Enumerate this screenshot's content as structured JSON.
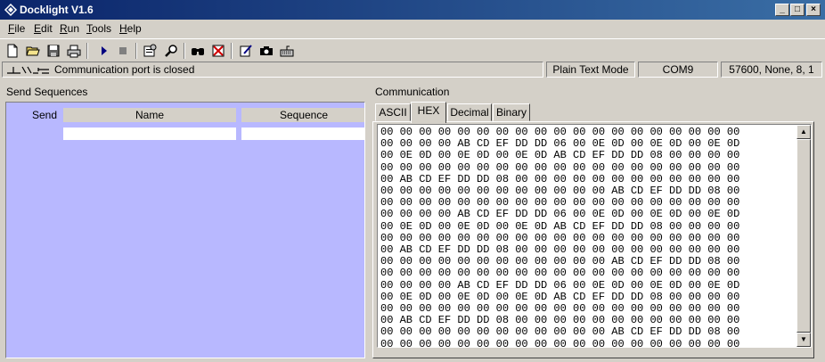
{
  "window": {
    "title": "Docklight V1.6"
  },
  "menu": [
    {
      "pre": "",
      "ul": "F",
      "post": "ile"
    },
    {
      "pre": "",
      "ul": "E",
      "post": "dit"
    },
    {
      "pre": "",
      "ul": "R",
      "post": "un"
    },
    {
      "pre": "",
      "ul": "T",
      "post": "ools"
    },
    {
      "pre": "",
      "ul": "H",
      "post": "elp"
    }
  ],
  "toolbar_icons": [
    "new-document-icon",
    "open-folder-icon",
    "save-disk-icon",
    "print-icon",
    "run-play-icon",
    "stop-icon",
    "settings-icon",
    "find-icon",
    "binoculars-icon",
    "clear-icon",
    "edit-icon",
    "snapshot-camera-icon",
    "keyboard-icon"
  ],
  "status": {
    "port_message": "Communication port is closed",
    "mode": "Plain Text Mode",
    "port": "COM9",
    "settings": "57600, None, 8, 1"
  },
  "send_sequences": {
    "label": "Send Sequences",
    "columns": {
      "send": "Send",
      "name": "Name",
      "sequence": "Sequence"
    }
  },
  "communication": {
    "label": "Communication",
    "tabs": [
      "ASCII",
      "HEX",
      "Decimal",
      "Binary"
    ],
    "active_tab": "HEX",
    "hex_lines": [
      "00 00 00 00 00 00 00 00 00 00 00 00 00 00 00 00 00 00 00",
      "00 00 00 00 AB CD EF DD DD 06 00 0E 0D 00 0E 0D 00 0E 0D",
      "00 0E 0D 00 0E 0D 00 0E 0D AB CD EF DD DD 08 00 00 00 00",
      "00 00 00 00 00 00 00 00 00 00 00 00 00 00 00 00 00 00 00",
      "00 AB CD EF DD DD 08 00 00 00 00 00 00 00 00 00 00 00 00",
      "00 00 00 00 00 00 00 00 00 00 00 00 AB CD EF DD DD 08 00",
      "00 00 00 00 00 00 00 00 00 00 00 00 00 00 00 00 00 00 00",
      "00 00 00 00 AB CD EF DD DD 06 00 0E 0D 00 0E 0D 00 0E 0D",
      "00 0E 0D 00 0E 0D 00 0E 0D AB CD EF DD DD 08 00 00 00 00",
      "00 00 00 00 00 00 00 00 00 00 00 00 00 00 00 00 00 00 00",
      "00 AB CD EF DD DD 08 00 00 00 00 00 00 00 00 00 00 00 00",
      "00 00 00 00 00 00 00 00 00 00 00 00 AB CD EF DD DD 08 00",
      "00 00 00 00 00 00 00 00 00 00 00 00 00 00 00 00 00 00 00",
      "00 00 00 00 AB CD EF DD DD 06 00 0E 0D 00 0E 0D 00 0E 0D",
      "00 0E 0D 00 0E 0D 00 0E 0D AB CD EF DD DD 08 00 00 00 00",
      "00 00 00 00 00 00 00 00 00 00 00 00 00 00 00 00 00 00 00",
      "00 AB CD EF DD DD 08 00 00 00 00 00 00 00 00 00 00 00 00",
      "00 00 00 00 00 00 00 00 00 00 00 00 AB CD EF DD DD 08 00",
      "00 00 00 00 00 00 00 00 00 00 00 00 00 00 00 00 00 00 00"
    ]
  },
  "colors": {
    "title_from": "#0a246a",
    "title_to": "#3a6ea5",
    "send_panel_bg": "#b8b8ff",
    "face": "#d4d0c8"
  }
}
